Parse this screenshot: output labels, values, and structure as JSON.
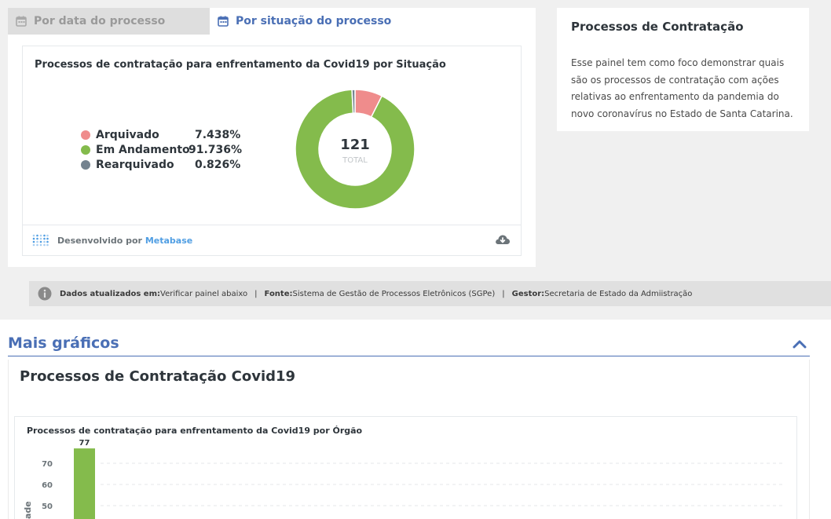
{
  "tabs": [
    {
      "label": "Por data do processo",
      "icon": "calendar-icon",
      "active": false
    },
    {
      "label": "Por situação do processo",
      "icon": "calendar-icon",
      "active": true
    }
  ],
  "donut_chart": {
    "title": "Processos de contratação para enfrentamento da Covid19 por Situação",
    "total_value": "121",
    "total_label": "TOTAL",
    "legend": [
      {
        "label": "Arquivado",
        "percent": "7.438%",
        "color": "#ef8c8c"
      },
      {
        "label": "Em Andamento",
        "percent": "91.736%",
        "color": "#84bb4c"
      },
      {
        "label": "Rearquivado",
        "percent": "0.826%",
        "color": "#74838f"
      }
    ],
    "footer_text": "Desenvolvido por ",
    "footer_link": "Metabase"
  },
  "info_card": {
    "title": "Processos de Contratação",
    "body": "Esse painel tem como foco demonstrar quais são os processos de contratação com ações relativas ao enfrentamento da pandemia do novo coronavírus no Estado de Santa Catarina."
  },
  "info_bar": {
    "updated_label": "Dados atualizados em:",
    "updated_value": " Verificar painel abaixo",
    "source_label": "Fonte:",
    "source_value": " Sistema de Gestão de Processos Eletrônicos (SGPe)",
    "manager_label": "Gestor:",
    "manager_value": " Secretaria de Estado da Admiistração",
    "separator": "|"
  },
  "more_charts": {
    "heading": "Mais gráficos",
    "section_title": "Processos de Contratação Covid19",
    "bar_chart_title": "Processos de contratação para enfrentamento da Covid19 por Órgão",
    "y_axis_label_partial": "ade"
  },
  "chart_data": [
    {
      "type": "pie",
      "title": "Processos de contratação para enfrentamento da Covid19 por Situação",
      "categories": [
        "Arquivado",
        "Em Andamento",
        "Rearquivado"
      ],
      "values": [
        7.438,
        91.736,
        0.826
      ],
      "total": 121,
      "colors": [
        "#ef8c8c",
        "#84bb4c",
        "#74838f"
      ]
    },
    {
      "type": "bar",
      "title": "Processos de contratação para enfrentamento da Covid19 por Órgão",
      "values": [
        77
      ],
      "y_ticks": [
        50,
        60,
        70
      ],
      "color": "#84bb4c",
      "grid": true
    }
  ]
}
